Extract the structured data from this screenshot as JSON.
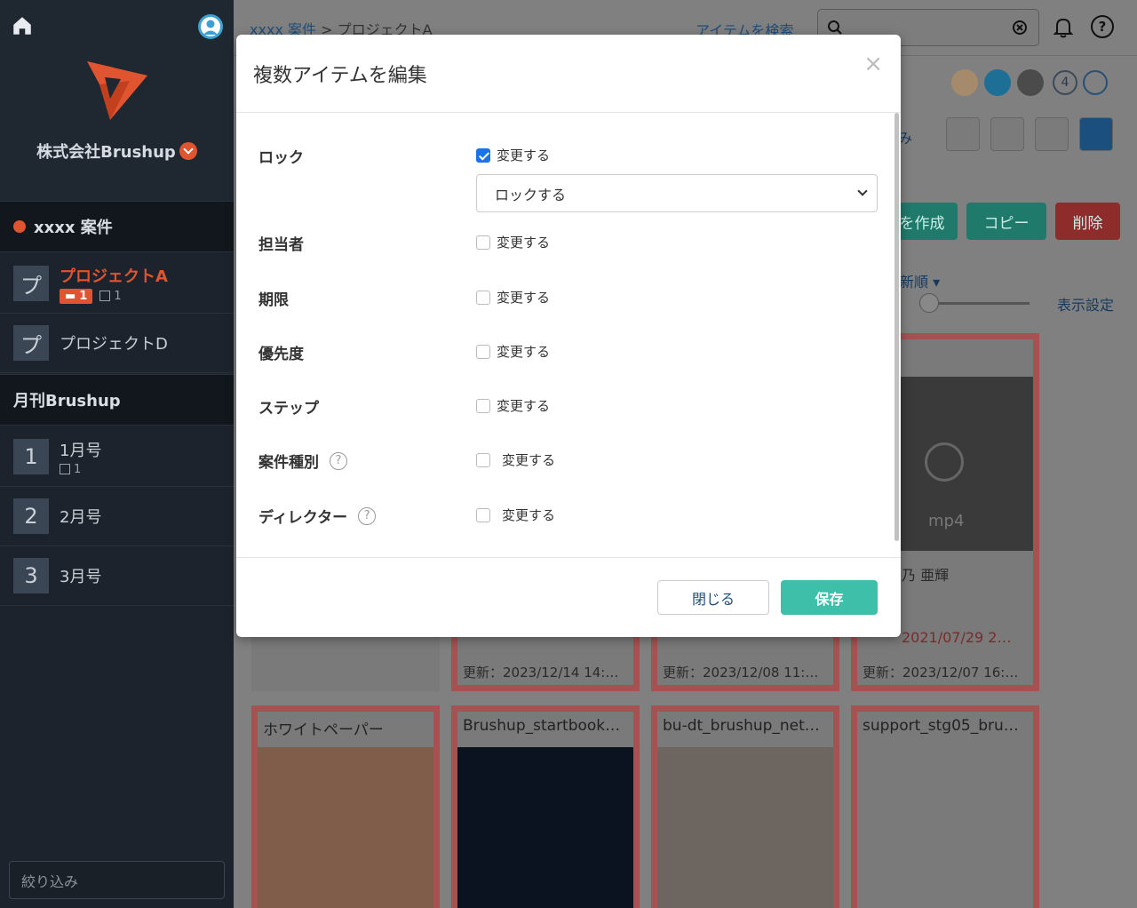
{
  "sidebar": {
    "company": "株式会社Brushup",
    "sections": [
      {
        "title": "xxxx 案件",
        "items": [
          {
            "icon_char": "プ",
            "label": "プロジェクトA",
            "comments": "1",
            "tasks": "1"
          },
          {
            "icon_char": "プ",
            "label": "プロジェクトD"
          }
        ]
      },
      {
        "title": "月刊Brushup",
        "items": [
          {
            "icon_char": "1",
            "label": "1月号",
            "tasks": "1"
          },
          {
            "icon_char": "2",
            "label": "2月号"
          },
          {
            "icon_char": "3",
            "label": "3月号"
          }
        ]
      }
    ],
    "filter_placeholder": "絞り込み"
  },
  "header": {
    "breadcrumb_parent": "xxxx 案件",
    "breadcrumb_sep": ">",
    "breadcrumb_current": "プロジェクトA",
    "search_link": "アイテムを検索",
    "member_count": "4"
  },
  "toolbar": {
    "create_label": "を作成",
    "copy_label": "コピー",
    "delete_label": "削除",
    "sort_label": "新順",
    "display_settings": "表示設定",
    "partial_label": "み"
  },
  "cards_top": [
    {
      "updated": "更新：2023/12/14 14:…"
    },
    {
      "updated": "更新：2023/12/08 11:…"
    },
    {
      "updated": "更新：2023/12/07 16:…",
      "person": "乃 亜輝",
      "date": "2021/07/29 2…",
      "file_type": "mp4"
    }
  ],
  "cards_bottom": [
    {
      "title": "ホワイトペーパー"
    },
    {
      "title": "Brushup_startbook…"
    },
    {
      "title": "bu-dt_brushup_net…"
    },
    {
      "title": "support_stg05_bru…"
    }
  ],
  "modal": {
    "title": "複数アイテムを編集",
    "close_symbol": "×",
    "rows": [
      {
        "label": "ロック",
        "checkbox_label": "変更する",
        "checked": true,
        "help": false
      },
      {
        "label": "担当者",
        "checkbox_label": "変更する",
        "checked": false,
        "help": false
      },
      {
        "label": "期限",
        "checkbox_label": "変更する",
        "checked": false,
        "help": false
      },
      {
        "label": "優先度",
        "checkbox_label": "変更する",
        "checked": false,
        "help": false
      },
      {
        "label": "ステップ",
        "checkbox_label": "変更する",
        "checked": false,
        "help": false
      },
      {
        "label": "案件種別",
        "checkbox_label": "変更する",
        "checked": false,
        "help": true
      },
      {
        "label": "ディレクター",
        "checkbox_label": "変更する",
        "checked": false,
        "help": true
      }
    ],
    "lock_select_value": "ロックする",
    "help_symbol": "?",
    "close_button": "閉じる",
    "save_button": "保存"
  },
  "colors": {
    "accent": "#e0542f",
    "save": "#3dbfa9",
    "link": "#1e4d7a",
    "sidebar_bg": "#1d232c"
  }
}
